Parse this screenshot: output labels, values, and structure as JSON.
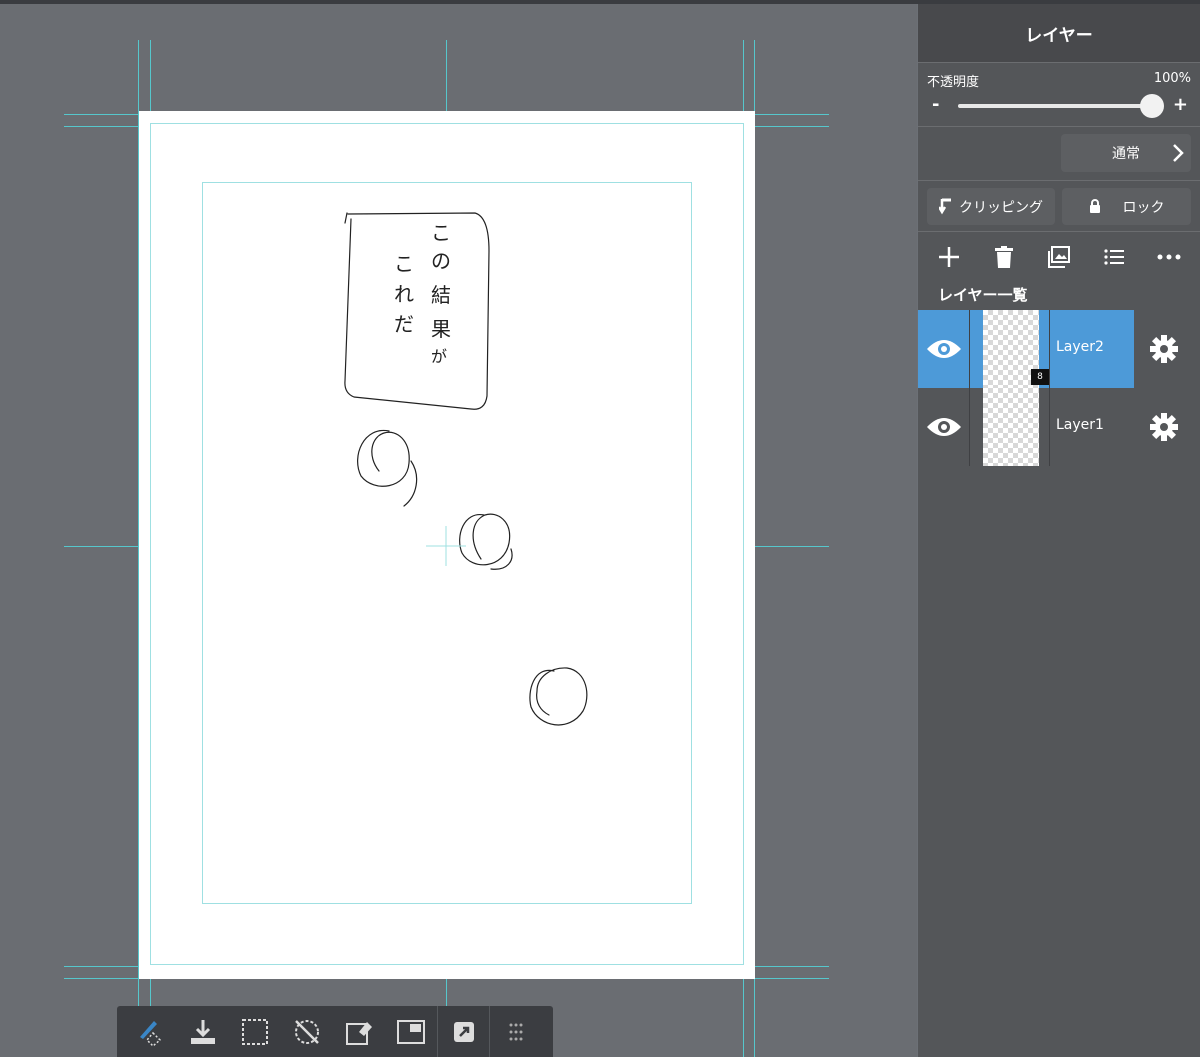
{
  "panel": {
    "title": "レイヤー",
    "opacity_label": "不透明度",
    "opacity_value": "100%",
    "opacity_level": 1.0,
    "minus": "-",
    "plus": "+",
    "blend_mode": "通常",
    "clipping_label": "クリッピング",
    "lock_label": "ロック",
    "list_title": "レイヤー一覧",
    "actions": [
      "plus-icon",
      "trash-icon",
      "image-icon",
      "list-icon",
      "more-icon"
    ],
    "layers": [
      {
        "name": "Layer2",
        "visible": true,
        "active": true,
        "badge": "8"
      },
      {
        "name": "Layer1",
        "visible": true,
        "active": false
      }
    ]
  },
  "toolbar": {
    "tools": [
      "brush-eraser-icon",
      "download-icon",
      "selection-icon",
      "rotate-reset-icon",
      "eraser-box-icon",
      "frame-icon",
      "export-icon",
      "grip-icon"
    ]
  },
  "canvas": {
    "handwriting": [
      "こ",
      "の",
      "結",
      "果",
      "が",
      "こ",
      "れ",
      "だ"
    ]
  },
  "colors": {
    "accent": "#4d9ad8",
    "guide": "#56c7cc",
    "panel": "#545659"
  }
}
